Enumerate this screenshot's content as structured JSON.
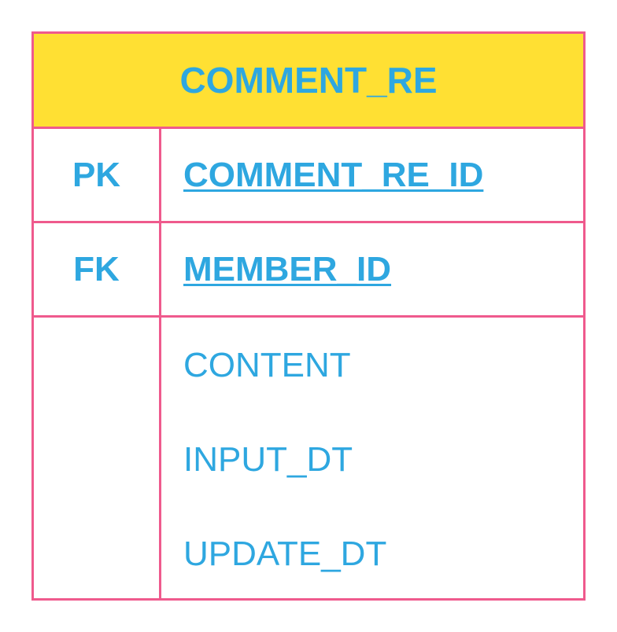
{
  "entity": {
    "name": "COMMENT_RE",
    "keys": [
      {
        "type": "PK",
        "field": "COMMENT_RE_ID"
      },
      {
        "type": "FK",
        "field": "MEMBER_ID"
      }
    ],
    "attributes": [
      "CONTENT",
      "INPUT_DT",
      "UPDATE_DT"
    ]
  },
  "colors": {
    "border": "#ef5a8d",
    "header_background": "#ffe033",
    "text": "#2ea7e0",
    "background": "#ffffff"
  }
}
